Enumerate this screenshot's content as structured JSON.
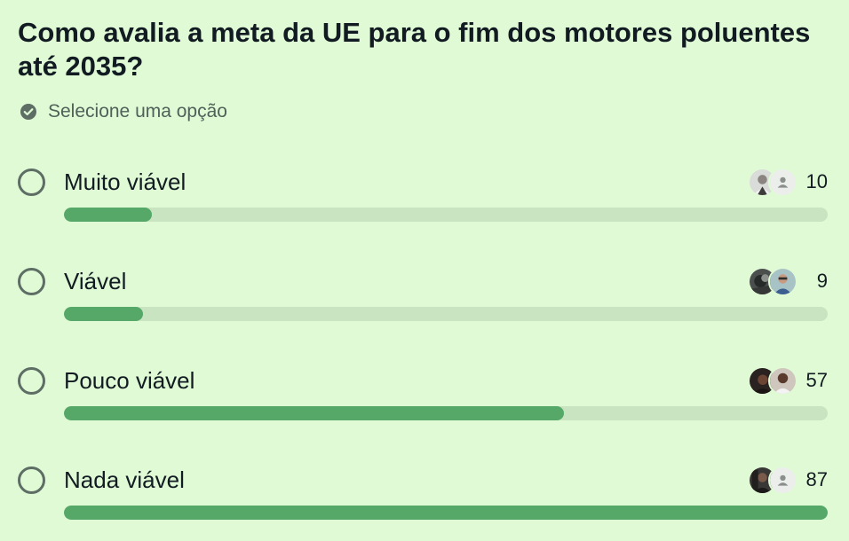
{
  "poll": {
    "question": "Como avalia a meta da UE para o fim dos motores poluentes até 2035?",
    "instruction": "Selecione uma opção",
    "max_votes": 87,
    "options": [
      {
        "label": "Muito viável",
        "votes": "10",
        "voters": [
          "photo",
          "placeholder"
        ]
      },
      {
        "label": "Viável",
        "votes": "9",
        "voters": [
          "photo",
          "photo"
        ]
      },
      {
        "label": "Pouco viável",
        "votes": "57",
        "voters": [
          "photo",
          "photo"
        ]
      },
      {
        "label": "Nada viável",
        "votes": "87",
        "voters": [
          "photo",
          "placeholder"
        ]
      }
    ]
  },
  "colors": {
    "background": "#e0fad6",
    "bar_fill": "#56a869",
    "bar_track": "#c9e4c1",
    "radio_border": "#5e6e65"
  },
  "icons": {
    "instruction": "check-circle-icon",
    "option_select": "radio-circle-icon",
    "voter_placeholder": "person-icon"
  }
}
